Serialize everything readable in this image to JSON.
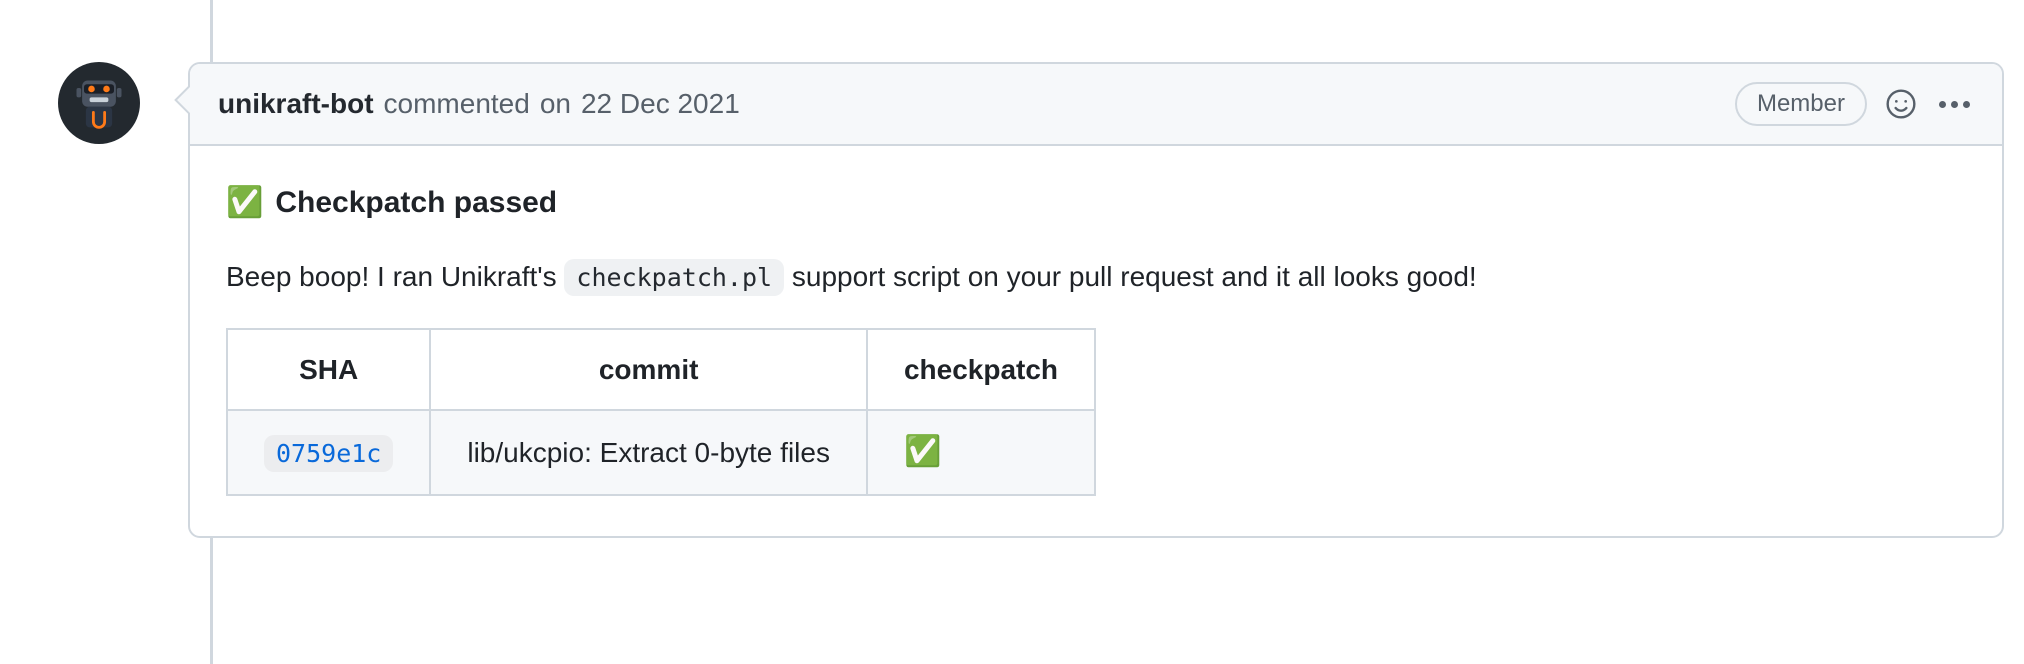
{
  "comment": {
    "author": "unikraft-bot",
    "action_text": "commented",
    "date_prefix": "on",
    "date": "22 Dec 2021",
    "badge": "Member"
  },
  "body": {
    "heading_emoji": "✅",
    "heading_text": "Checkpatch passed",
    "para_before": "Beep boop! I ran Unikraft's ",
    "code_chip": "checkpatch.pl",
    "para_after": " support script on your pull request and it all looks good!"
  },
  "table": {
    "headers": {
      "sha": "SHA",
      "commit": "commit",
      "checkpatch": "checkpatch"
    },
    "row": {
      "sha": "0759e1c",
      "commit_msg": "lib/ukcpio: Extract 0-byte files",
      "status_emoji": "✅"
    }
  }
}
